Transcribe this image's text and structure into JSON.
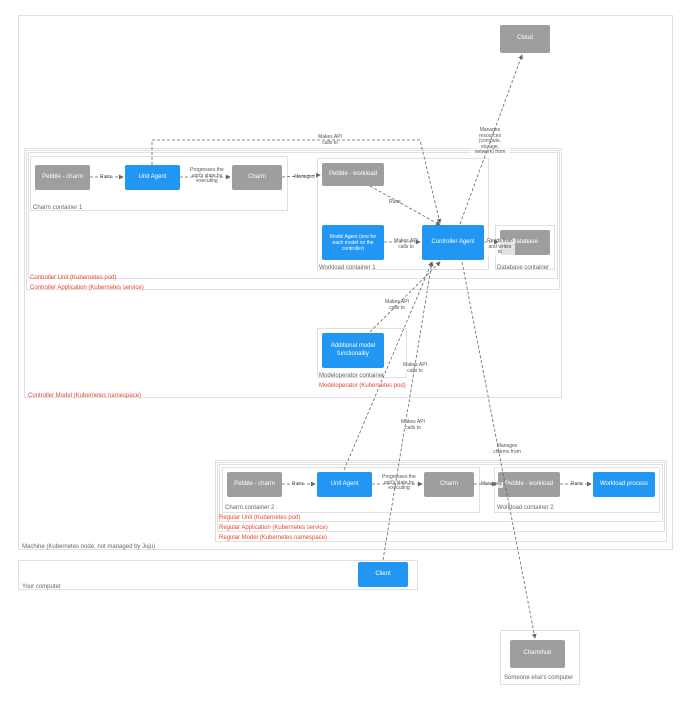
{
  "chart_data": {
    "type": "diagram",
    "title": "",
    "nodes": [
      {
        "id": "cloud",
        "label": "Cloud",
        "style": "gray"
      },
      {
        "id": "pebble_charm_1",
        "label": "Pebble - charm",
        "style": "gray"
      },
      {
        "id": "unit_agent_1",
        "label": "Unit Agent",
        "style": "blue"
      },
      {
        "id": "prog_1",
        "label": "Progresses the unit's state by executing",
        "style": "text"
      },
      {
        "id": "charm_1",
        "label": "Charm",
        "style": "gray"
      },
      {
        "id": "pebble_workload_1",
        "label": "Pebble - workload",
        "style": "gray"
      },
      {
        "id": "model_agent",
        "label": "Model Agent (one for each model on the controller)",
        "style": "blue"
      },
      {
        "id": "controller_agent",
        "label": "Controller Agent",
        "style": "blue"
      },
      {
        "id": "database",
        "label": "Database",
        "style": "gray"
      },
      {
        "id": "additional_model",
        "label": "Additional model functionality",
        "style": "blue"
      },
      {
        "id": "pebble_charm_2",
        "label": "Pebble - charm",
        "style": "gray"
      },
      {
        "id": "unit_agent_2",
        "label": "Unit Agent",
        "style": "blue"
      },
      {
        "id": "prog_2",
        "label": "Progresses the unit's state by executing",
        "style": "text"
      },
      {
        "id": "charm_2",
        "label": "Charm",
        "style": "gray"
      },
      {
        "id": "pebble_workload_2",
        "label": "Pebble - workload",
        "style": "gray"
      },
      {
        "id": "workload_process",
        "label": "Workload process",
        "style": "blue"
      },
      {
        "id": "client",
        "label": "Client",
        "style": "blue"
      },
      {
        "id": "charmhub",
        "label": "Charmhub",
        "style": "gray"
      }
    ],
    "edges": [
      {
        "from": "controller_agent",
        "to": "cloud",
        "label": "Manages resources (compute, storage, network) from"
      },
      {
        "from": "unit_agent_1",
        "to": "controller_agent",
        "label": "Makes API calls to"
      },
      {
        "from": "pebble_charm_1",
        "to": "unit_agent_1",
        "label": "Runs"
      },
      {
        "from": "unit_agent_1",
        "to": "charm_1",
        "via": "prog_1"
      },
      {
        "from": "charm_1",
        "to": "pebble_workload_1",
        "label": "Manages"
      },
      {
        "from": "pebble_workload_1",
        "to": "controller_agent",
        "label": "Runs"
      },
      {
        "from": "model_agent",
        "to": "controller_agent",
        "label": "Makes API calls to"
      },
      {
        "from": "controller_agent",
        "to": "database",
        "label": "Reads from and writes to"
      },
      {
        "from": "additional_model",
        "to": "controller_agent",
        "label": "Makes API calls to"
      },
      {
        "from": "unit_agent_2",
        "to": "controller_agent",
        "label": "Makes API calls to"
      },
      {
        "from": "pebble_charm_2",
        "to": "unit_agent_2",
        "label": "Runs"
      },
      {
        "from": "unit_agent_2",
        "to": "charm_2",
        "via": "prog_2"
      },
      {
        "from": "charm_2",
        "to": "pebble_workload_2",
        "label": "Manages"
      },
      {
        "from": "pebble_workload_2",
        "to": "workload_process",
        "label": "Runs"
      },
      {
        "from": "client",
        "to": "controller_agent"
      },
      {
        "from": "controller_agent",
        "to": "charmhub",
        "label": "Manages charms from"
      }
    ],
    "containers": [
      {
        "id": "charm_container_1",
        "label": "Charm container 1",
        "contains": [
          "pebble_charm_1",
          "unit_agent_1",
          "prog_1",
          "charm_1"
        ]
      },
      {
        "id": "workload_container_1",
        "label": "Workload container 1",
        "contains": [
          "pebble_workload_1",
          "model_agent",
          "controller_agent"
        ]
      },
      {
        "id": "database_container",
        "label": "Database container",
        "contains": [
          "database"
        ]
      },
      {
        "id": "controller_unit",
        "label": "Controller Unit (Kubernetes pod)",
        "style": "red",
        "contains": [
          "charm_container_1",
          "workload_container_1",
          "database_container"
        ]
      },
      {
        "id": "controller_app",
        "label": "Controller Application (Kubernetes service)",
        "style": "red",
        "contains": [
          "controller_unit"
        ]
      },
      {
        "id": "modeloperator_container",
        "label": "Modeloperator container",
        "contains": [
          "additional_model"
        ]
      },
      {
        "id": "modeloperator",
        "label": "Modeloperator (Kubernetes pod)",
        "style": "red",
        "contains": [
          "modeloperator_container"
        ]
      },
      {
        "id": "controller_model",
        "label": "Controller Model (Kubernetes namespace)",
        "style": "red",
        "contains": [
          "controller_app",
          "modeloperator"
        ]
      },
      {
        "id": "charm_container_2",
        "label": "Charm container 2",
        "contains": [
          "pebble_charm_2",
          "unit_agent_2",
          "prog_2",
          "charm_2"
        ]
      },
      {
        "id": "workload_container_2",
        "label": "Workload container 2",
        "contains": [
          "pebble_workload_2",
          "workload_process"
        ]
      },
      {
        "id": "regular_unit",
        "label": "Regular Unit (Kubernetes pod)",
        "style": "red",
        "contains": [
          "charm_container_2",
          "workload_container_2"
        ]
      },
      {
        "id": "regular_app",
        "label": "Regular Application (Kubernetes service)",
        "style": "red",
        "contains": [
          "regular_unit"
        ]
      },
      {
        "id": "regular_model",
        "label": "Regular Model (Kubernetes namespace)",
        "style": "red",
        "contains": [
          "regular_app"
        ]
      },
      {
        "id": "machine",
        "label": "Machine (Kubernetes node; not managed by Juju)",
        "contains": [
          "controller_model",
          "regular_model"
        ]
      },
      {
        "id": "your_computer",
        "label": "Your computer",
        "contains": [
          "client"
        ]
      },
      {
        "id": "someone_else",
        "label": "Someone else's computer",
        "contains": [
          "charmhub"
        ]
      }
    ]
  },
  "labels": {
    "machine": "Machine (Kubernetes node; not managed by Juju)",
    "controller_model": "Controller Model (Kubernetes namespace)",
    "controller_app": "Controller Application (Kubernetes service)",
    "controller_unit": "Controller Unit (Kubernetes pod)",
    "charm_container_1": "Charm container 1",
    "workload_container_1": "Workload container 1",
    "database_container": "Database container",
    "modeloperator_container": "Modeloperator container",
    "modeloperator": "Modeloperator (Kubernetes pod)",
    "regular_model": "Regular Model (Kubernetes namespace)",
    "regular_app": "Regular Application (Kubernetes service)",
    "regular_unit": "Regular Unit (Kubernetes pod)",
    "charm_container_2": "Charm container 2",
    "workload_container_2": "Workload container 2",
    "your_computer": "Your computer",
    "someone_else": "Someone else's computer"
  },
  "nodes": {
    "cloud": "Cloud",
    "pebble_charm_1": "Pebble - charm",
    "unit_agent_1": "Unit Agent",
    "prog_1": "Progresses the unit's state by executing",
    "charm_1": "Charm",
    "pebble_workload_1": "Pebble - workload",
    "model_agent": "Model Agent (one for each model on the controller)",
    "controller_agent": "Controller Agent",
    "database": "Database",
    "additional_model": "Additional model functionality",
    "pebble_charm_2": "Pebble - charm",
    "unit_agent_2": "Unit Agent",
    "prog_2": "Progresses the unit's state by executing",
    "charm_2": "Charm",
    "pebble_workload_2": "Pebble - workload",
    "workload_process": "Workload process",
    "client": "Client",
    "charmhub": "Charmhub"
  },
  "edge_labels": {
    "runs": "Runs",
    "makes_api": "Makes API calls to",
    "manages": "Manages",
    "reads_writes": "Reads from and writes to",
    "manages_resources": "Manages resources (compute, storage, network) from",
    "manages_charms": "Manages charms from"
  }
}
